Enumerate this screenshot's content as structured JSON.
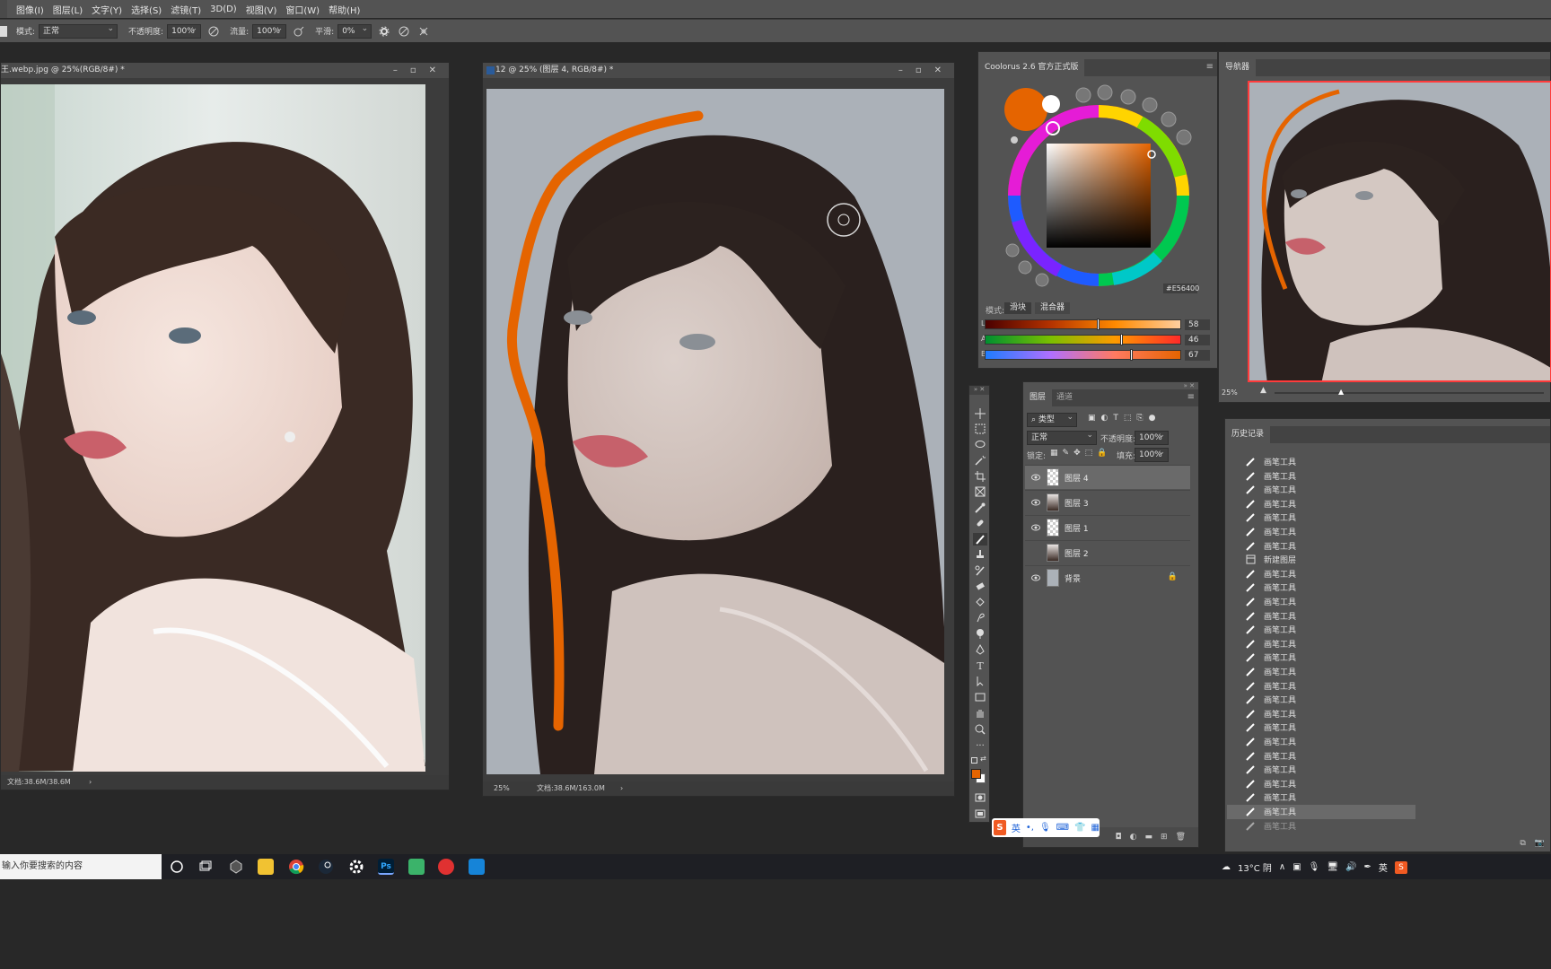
{
  "menubar": {
    "items": [
      "图像(I)",
      "图层(L)",
      "文字(Y)",
      "选择(S)",
      "滤镜(T)",
      "3D(D)",
      "视图(V)",
      "窗口(W)",
      "帮助(H)"
    ]
  },
  "options": {
    "mode_label": "模式:",
    "mode_value": "正常",
    "opacity_label": "不透明度:",
    "opacity_value": "100%",
    "flow_label": "流量:",
    "flow_value": "100%",
    "smooth_label": "平滑:",
    "smooth_value": "0%"
  },
  "doc_left": {
    "title": "王.webp.jpg @ 25%(RGB/8#) *",
    "status": "文档:38.6M/38.6M"
  },
  "doc_main": {
    "title": "12 @ 25% (图层 4, RGB/8#) *",
    "zoom": "25%",
    "status": "文档:38.6M/163.0M"
  },
  "coolorus": {
    "title": "Coolorus 2.6 官方正式版",
    "hex": "#E56400",
    "mode_label": "模式:",
    "tab_slider": "滑块",
    "tab_mixer": "混合器",
    "sliders": [
      {
        "letter": "L",
        "value": "58",
        "level": 0.58
      },
      {
        "letter": "A",
        "value": "46",
        "level": 0.7
      },
      {
        "letter": "B",
        "value": "67",
        "level": 0.75
      }
    ],
    "accent": "#e56400"
  },
  "navigator": {
    "title": "导航器",
    "zoom": "25%"
  },
  "layers": {
    "tab_layers": "图层",
    "tab_channels": "通道",
    "filter_kind": "类型",
    "blend_mode": "正常",
    "opacity_label": "不透明度:",
    "opacity_value": "100%",
    "lock_label": "锁定:",
    "fill_label": "填充:",
    "fill_value": "100%",
    "items": [
      {
        "name": "图层 4",
        "visible": true,
        "active": true
      },
      {
        "name": "图层 3",
        "visible": true,
        "active": false
      },
      {
        "name": "图层 1",
        "visible": true,
        "active": false
      },
      {
        "name": "图层 2",
        "visible": false,
        "active": false
      },
      {
        "name": "背景",
        "visible": true,
        "active": false
      }
    ]
  },
  "history": {
    "title": "历史记录",
    "items": [
      "画笔工具",
      "画笔工具",
      "画笔工具",
      "画笔工具",
      "画笔工具",
      "画笔工具",
      "画笔工具",
      "新建图层",
      "画笔工具",
      "画笔工具",
      "画笔工具",
      "画笔工具",
      "画笔工具",
      "画笔工具",
      "画笔工具",
      "画笔工具",
      "画笔工具",
      "画笔工具",
      "画笔工具",
      "画笔工具",
      "画笔工具",
      "画笔工具",
      "画笔工具",
      "画笔工具",
      "画笔工具",
      "画笔工具",
      "画笔工具"
    ]
  },
  "ime": {
    "lang": "英"
  },
  "taskbar": {
    "search_placeholder": "输入你要搜索的内容",
    "weather": "13°C 阴",
    "input_lang": "英"
  }
}
